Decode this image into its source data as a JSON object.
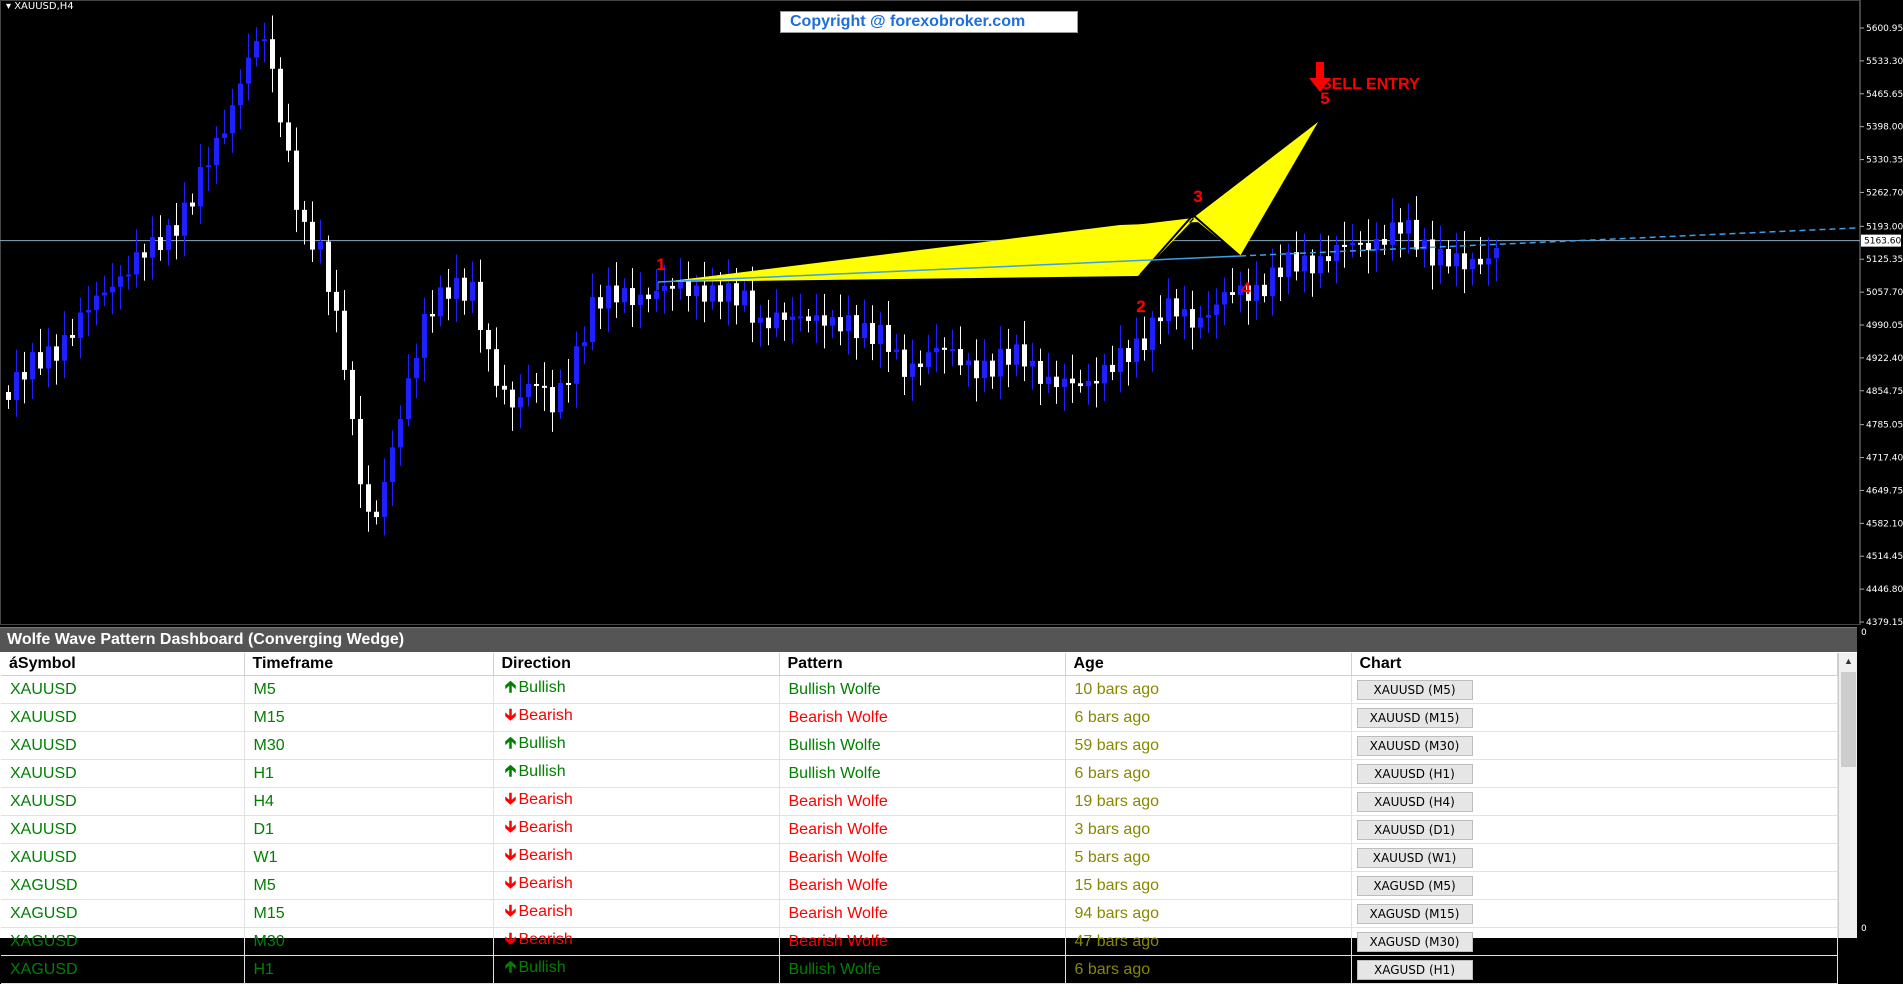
{
  "chart": {
    "symbol_label": "XAUUSD,H4",
    "copyright": "Copyright @ forexobroker.com",
    "current_price": "5163.60",
    "price_axis": [
      "5600.95",
      "5533.30",
      "5465.65",
      "5398.00",
      "5330.35",
      "5262.70",
      "5193.00",
      "5125.35",
      "5057.70",
      "4990.05",
      "4922.40",
      "4854.75",
      "4785.05",
      "4717.40",
      "4649.75",
      "4582.10",
      "4514.45",
      "4446.80",
      "4379.15"
    ],
    "wave_labels": [
      "1",
      "2",
      "3",
      "4",
      "5"
    ],
    "signal_text": "SELL ENTRY",
    "colors": {
      "bull_candle": "#1f1fff",
      "bear_candle": "#ffffff",
      "wedge": "#ffff00",
      "wave_label": "#ff0000",
      "trend_line": "#3aa0e8"
    }
  },
  "dashboard": {
    "title": "Wolfe Wave Pattern Dashboard (Converging Wedge)",
    "columns": [
      "áSymbol",
      "Timeframe",
      "Direction",
      "Pattern",
      "Age",
      "Chart"
    ],
    "rows": [
      {
        "symbol": "XAUUSD",
        "timeframe": "M5",
        "direction": "Bullish",
        "pattern": "Bullish Wolfe",
        "age": "10 bars ago",
        "chart": "XAUUSD (M5)"
      },
      {
        "symbol": "XAUUSD",
        "timeframe": "M15",
        "direction": "Bearish",
        "pattern": "Bearish Wolfe",
        "age": "6 bars ago",
        "chart": "XAUUSD (M15)"
      },
      {
        "symbol": "XAUUSD",
        "timeframe": "M30",
        "direction": "Bullish",
        "pattern": "Bullish Wolfe",
        "age": "59 bars ago",
        "chart": "XAUUSD (M30)"
      },
      {
        "symbol": "XAUUSD",
        "timeframe": "H1",
        "direction": "Bullish",
        "pattern": "Bullish Wolfe",
        "age": "6 bars ago",
        "chart": "XAUUSD (H1)"
      },
      {
        "symbol": "XAUUSD",
        "timeframe": "H4",
        "direction": "Bearish",
        "pattern": "Bearish Wolfe",
        "age": "19 bars ago",
        "chart": "XAUUSD (H4)"
      },
      {
        "symbol": "XAUUSD",
        "timeframe": "D1",
        "direction": "Bearish",
        "pattern": "Bearish Wolfe",
        "age": "3 bars ago",
        "chart": "XAUUSD (D1)"
      },
      {
        "symbol": "XAUUSD",
        "timeframe": "W1",
        "direction": "Bearish",
        "pattern": "Bearish Wolfe",
        "age": "5 bars ago",
        "chart": "XAUUSD (W1)"
      },
      {
        "symbol": "XAGUSD",
        "timeframe": "M5",
        "direction": "Bearish",
        "pattern": "Bearish Wolfe",
        "age": "15 bars ago",
        "chart": "XAGUSD (M5)"
      },
      {
        "symbol": "XAGUSD",
        "timeframe": "M15",
        "direction": "Bearish",
        "pattern": "Bearish Wolfe",
        "age": "94 bars ago",
        "chart": "XAGUSD (M15)"
      },
      {
        "symbol": "XAGUSD",
        "timeframe": "M30",
        "direction": "Bearish",
        "pattern": "Bearish Wolfe",
        "age": "47 bars ago",
        "chart": "XAGUSD (M30)"
      },
      {
        "symbol": "XAGUSD",
        "timeframe": "H1",
        "direction": "Bullish",
        "pattern": "Bullish Wolfe",
        "age": "6 bars ago",
        "chart": "XAGUSD (H1)"
      }
    ],
    "zero_labels": [
      "0",
      "0"
    ]
  }
}
